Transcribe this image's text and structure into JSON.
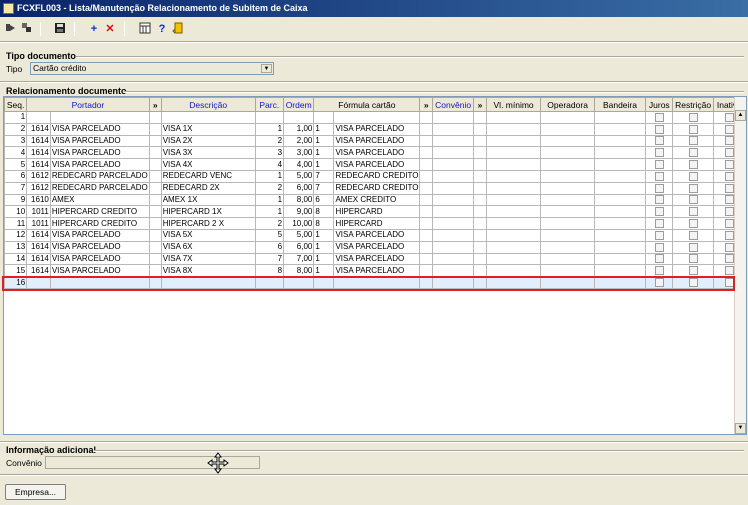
{
  "window": {
    "title": "FCXFL003 - Lista/Manutenção Relacionamento de Subitem de Caixa"
  },
  "toolbar": {
    "icons": [
      "first-record-icon",
      "next-record-icon",
      "save-icon",
      "add-icon",
      "delete-icon",
      "calculator-icon",
      "help-icon",
      "exit-icon"
    ]
  },
  "tipo_documento": {
    "group_label": "Tipo documento",
    "field_label": "Tipo",
    "value": "Cartão crédito"
  },
  "relacionamento": {
    "group_label": "Relacionamento documento",
    "columns": {
      "seq": "Seq.",
      "portador": "Portador",
      "portador_more": "»",
      "descricao": "Descrição",
      "parc": "Parc.",
      "ordem": "Ordem",
      "formula": "Fórmula cartão",
      "formula_more": "»",
      "convenio": "Convênio",
      "convenio_more": "»",
      "vl_minimo": "Vl. mínimo",
      "operadora": "Operadora",
      "bandeira": "Bandeira",
      "juros": "Juros",
      "restricao": "Restrição",
      "inativo": "Inativo"
    },
    "rows": [
      {
        "seq": "1",
        "cod": "",
        "portador": "",
        "descricao": "",
        "parc": "",
        "ordem": "",
        "fcod": "",
        "formula": ""
      },
      {
        "seq": "2",
        "cod": "1614",
        "portador": "VISA PARCELADO",
        "descricao": "VISA 1X",
        "parc": "1",
        "ordem": "1,00",
        "fcod": "1",
        "formula": "VISA PARCELADO"
      },
      {
        "seq": "3",
        "cod": "1614",
        "portador": "VISA PARCELADO",
        "descricao": "VISA 2X",
        "parc": "2",
        "ordem": "2,00",
        "fcod": "1",
        "formula": "VISA PARCELADO"
      },
      {
        "seq": "4",
        "cod": "1614",
        "portador": "VISA PARCELADO",
        "descricao": "VISA 3X",
        "parc": "3",
        "ordem": "3,00",
        "fcod": "1",
        "formula": "VISA PARCELADO"
      },
      {
        "seq": "5",
        "cod": "1614",
        "portador": "VISA PARCELADO",
        "descricao": "VISA 4X",
        "parc": "4",
        "ordem": "4,00",
        "fcod": "1",
        "formula": "VISA PARCELADO"
      },
      {
        "seq": "6",
        "cod": "1612",
        "portador": "REDECARD PARCELADO",
        "descricao": "REDECARD VENC",
        "parc": "1",
        "ordem": "5,00",
        "fcod": "7",
        "formula": "REDECARD CREDITO"
      },
      {
        "seq": "7",
        "cod": "1612",
        "portador": "REDECARD PARCELADO",
        "descricao": "REDECARD 2X",
        "parc": "2",
        "ordem": "6,00",
        "fcod": "7",
        "formula": "REDECARD CREDITO"
      },
      {
        "seq": "9",
        "cod": "1610",
        "portador": "AMEX",
        "descricao": "AMEX 1X",
        "parc": "1",
        "ordem": "8,00",
        "fcod": "6",
        "formula": "AMEX CREDITO"
      },
      {
        "seq": "10",
        "cod": "1011",
        "portador": "HIPERCARD CREDITO",
        "descricao": "HIPERCARD 1X",
        "parc": "1",
        "ordem": "9,00",
        "fcod": "8",
        "formula": "HIPERCARD"
      },
      {
        "seq": "11",
        "cod": "1011",
        "portador": "HIPERCARD CREDITO",
        "descricao": "HIPERCARD 2 X",
        "parc": "2",
        "ordem": "10,00",
        "fcod": "8",
        "formula": "HIPERCARD"
      },
      {
        "seq": "12",
        "cod": "1614",
        "portador": "VISA PARCELADO",
        "descricao": "VISA 5X",
        "parc": "5",
        "ordem": "5,00",
        "fcod": "1",
        "formula": "VISA PARCELADO"
      },
      {
        "seq": "13",
        "cod": "1614",
        "portador": "VISA PARCELADO",
        "descricao": "VISA 6X",
        "parc": "6",
        "ordem": "6,00",
        "fcod": "1",
        "formula": "VISA PARCELADO"
      },
      {
        "seq": "14",
        "cod": "1614",
        "portador": "VISA PARCELADO",
        "descricao": "VISA 7X",
        "parc": "7",
        "ordem": "7,00",
        "fcod": "1",
        "formula": "VISA PARCELADO"
      },
      {
        "seq": "15",
        "cod": "1614",
        "portador": "VISA PARCELADO",
        "descricao": "VISA 8X",
        "parc": "8",
        "ordem": "8,00",
        "fcod": "1",
        "formula": "VISA PARCELADO"
      },
      {
        "seq": "16",
        "cod": "",
        "portador": "",
        "descricao": "",
        "parc": "",
        "ordem": "",
        "fcod": "",
        "formula": ""
      }
    ]
  },
  "informacao": {
    "group_label": "Informação adicional",
    "convenio_label": "Convênio",
    "convenio_value": ""
  },
  "buttons": {
    "empresa": "Empresa..."
  },
  "colors": {
    "title_start": "#0a246a",
    "title_end": "#3a6ea5",
    "header_blue": "#1515c8",
    "highlight": "#e02020",
    "new_row": "#e1eefc"
  }
}
